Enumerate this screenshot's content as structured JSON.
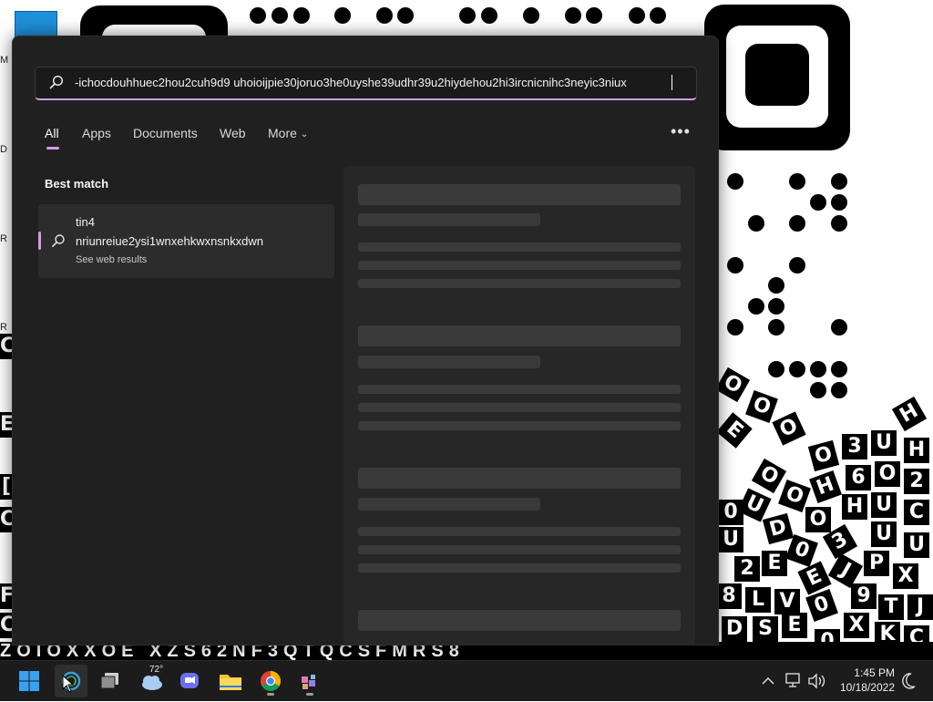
{
  "search": {
    "query": "-ichocdouhhuec2hou2cuh9d9 uhoioijpie30joruo3he0uyshe39udhr39u2hiydehou2hi3ircnicnihc3neyic3niux"
  },
  "tabs": [
    {
      "label": "All"
    },
    {
      "label": "Apps"
    },
    {
      "label": "Documents"
    },
    {
      "label": "Web"
    },
    {
      "label": "More"
    }
  ],
  "best_match": {
    "section_title": "Best match",
    "line1": "tin4",
    "line2": "nriunreiue2ysi1wnxehkwxnsnkxdwn",
    "subtitle": "See web results"
  },
  "taskbar": {
    "weather_temp": "72°",
    "apps": [
      "start-icon",
      "search-icon",
      "task-view-icon",
      "weather-icon",
      "chat-icon",
      "file-explorer-icon",
      "chrome-icon",
      "app-icon"
    ]
  },
  "clock": {
    "time": "1:45 PM",
    "date": "10/18/2022"
  },
  "colors": {
    "accent": "#d29be6",
    "panel_bg": "#202020",
    "taskbar_bg": "#1c1c1c"
  }
}
